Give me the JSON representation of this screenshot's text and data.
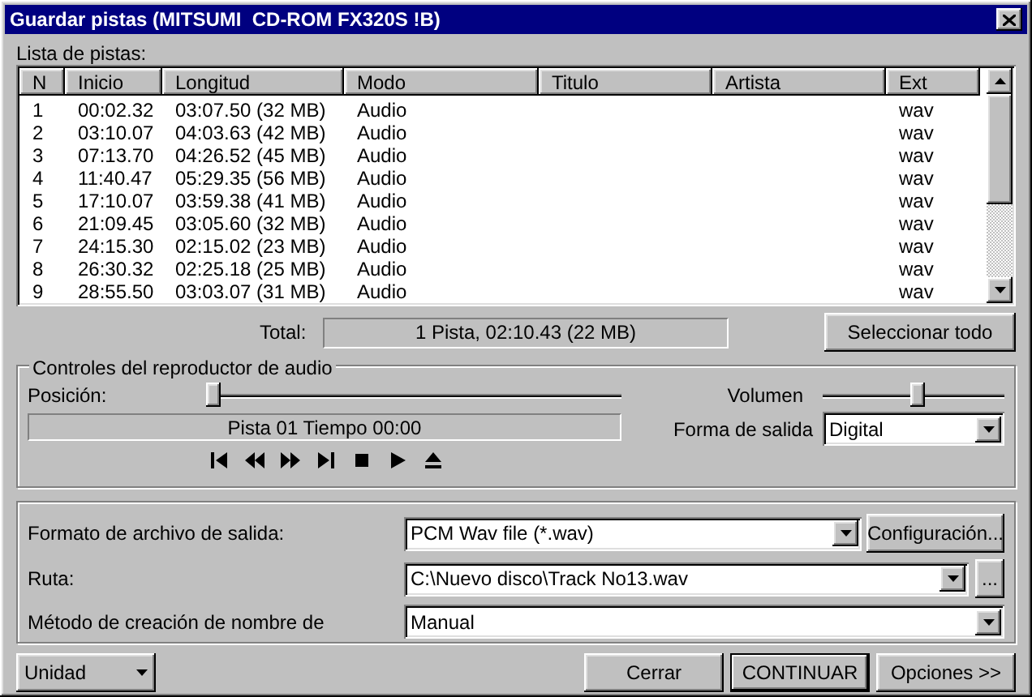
{
  "window": {
    "title": "Guardar pistas (MITSUMI  CD-ROM FX320S !B)"
  },
  "track_list": {
    "label": "Lista de pistas:",
    "columns": [
      "N",
      "Inicio",
      "Longitud",
      "Modo",
      "Titulo",
      "Artista",
      "Ext"
    ],
    "rows": [
      {
        "n": "1",
        "start": "00:02.32",
        "length": "03:07.50 (32 MB)",
        "mode": "Audio",
        "ext": "wav"
      },
      {
        "n": "2",
        "start": "03:10.07",
        "length": "04:03.63 (42 MB)",
        "mode": "Audio",
        "ext": "wav"
      },
      {
        "n": "3",
        "start": "07:13.70",
        "length": "04:26.52 (45 MB)",
        "mode": "Audio",
        "ext": "wav"
      },
      {
        "n": "4",
        "start": "11:40.47",
        "length": "05:29.35 (56 MB)",
        "mode": "Audio",
        "ext": "wav"
      },
      {
        "n": "5",
        "start": "17:10.07",
        "length": "03:59.38 (41 MB)",
        "mode": "Audio",
        "ext": "wav"
      },
      {
        "n": "6",
        "start": "21:09.45",
        "length": "03:05.60 (32 MB)",
        "mode": "Audio",
        "ext": "wav"
      },
      {
        "n": "7",
        "start": "24:15.30",
        "length": "02:15.02 (23 MB)",
        "mode": "Audio",
        "ext": "wav"
      },
      {
        "n": "8",
        "start": "26:30.32",
        "length": "02:25.18 (25 MB)",
        "mode": "Audio",
        "ext": "wav"
      },
      {
        "n": "9",
        "start": "28:55.50",
        "length": "03:03.07 (31 MB)",
        "mode": "Audio",
        "ext": "wav"
      }
    ]
  },
  "total": {
    "label": "Total:",
    "value": "1 Pista, 02:10.43 (22 MB)"
  },
  "select_all_button": "Seleccionar todo",
  "player": {
    "title": "Controles del reproductor de audio",
    "position": {
      "label": "Posición:",
      "level": 0.0
    },
    "status": "Pista 01 Tiempo 00:00",
    "volume": {
      "label": "Volumen",
      "level": 0.52
    },
    "output": {
      "label": "Forma de salida",
      "value": "Digital"
    }
  },
  "output_settings": [
    {
      "label": "Formato de archivo de salida:",
      "value": "PCM Wav file (*.wav)",
      "button": "Configuración..."
    },
    {
      "label": "Ruta:",
      "value": "C:\\Nuevo disco\\Track No13.wav",
      "button": "..."
    },
    {
      "label": "Método de creación de nombre de",
      "value": "Manual"
    }
  ],
  "unit_button": "Unidad",
  "buttons": [
    "Cerrar",
    "CONTINUAR",
    "Opciones >>"
  ]
}
